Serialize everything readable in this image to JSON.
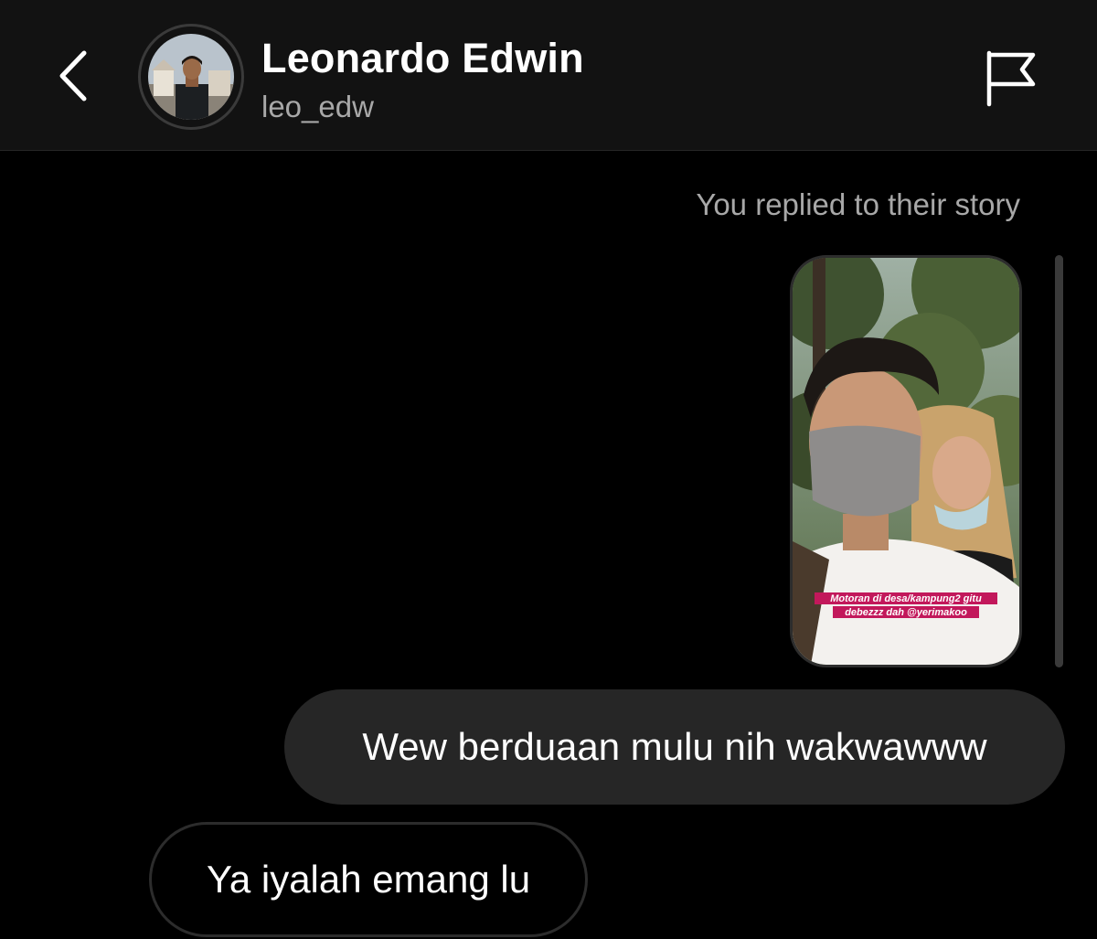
{
  "header": {
    "name": "Leonardo Edwin",
    "username": "leo_edw",
    "back_icon": "chevron-left-icon",
    "flag_icon": "flag-icon"
  },
  "thread": {
    "reply_note": "You replied to their story",
    "story": {
      "caption_line1": "Motoran di desa/kampung2 gitu",
      "caption_line2": "debezzz dah @yerimakoo"
    },
    "messages": [
      {
        "direction": "outgoing",
        "text": "Wew berduaan mulu nih wakwawww"
      },
      {
        "direction": "incoming",
        "text": "Ya iyalah emang lu"
      }
    ]
  },
  "colors": {
    "background": "#000000",
    "header": "#121212",
    "outgoing_bubble": "#262626",
    "secondary_text": "#a8a8a8",
    "caption_highlight": "#c2185b"
  }
}
